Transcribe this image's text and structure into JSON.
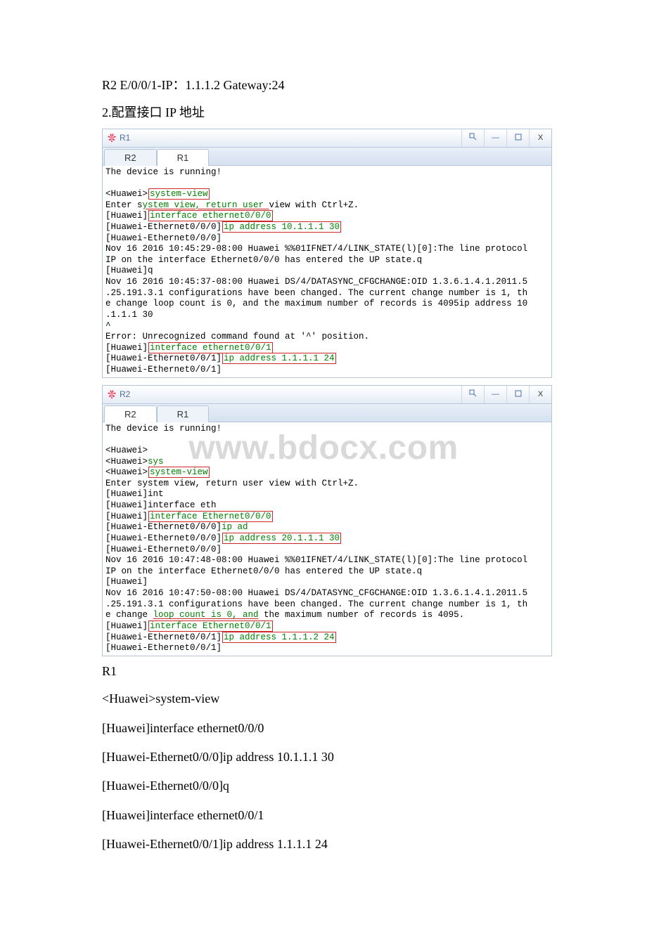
{
  "watermark": "www.bdocx.com",
  "heading1": "R2 E/0/0/1-IP：1.1.1.2 Gateway:24",
  "heading2": "2.配置接口 IP 地址",
  "windows": [
    {
      "title": "R1",
      "tabs": [
        "R2",
        "R1"
      ],
      "activeTab": 1,
      "lines": [
        {
          "pre": "The device is running!",
          "hl": ""
        },
        {
          "pre": "",
          "hl": ""
        },
        {
          "pre": "<Huawei>",
          "hl": "system-view"
        },
        {
          "pre": "Enter s",
          "underline": "ystem view, return user ",
          "post": "view with Ctrl+Z."
        },
        {
          "pre": "[Huawei]",
          "hl": "interface ethernet0/0/0"
        },
        {
          "pre": "[Huawei-Ethernet0/0/0]",
          "hl": "ip address 10.1.1.1 30"
        },
        {
          "pre": "[Huawei-Ethernet0/0/0]",
          "hl": ""
        },
        {
          "pre": "Nov 16 2016 10:45:29-08:00 Huawei %%01IFNET/4/LINK_STATE(l)[0]:The line protocol",
          "hl": ""
        },
        {
          "pre": " IP on the interface Ethernet0/0/0 has entered the UP state.q",
          "hl": ""
        },
        {
          "pre": "[Huawei]q",
          "hl": ""
        },
        {
          "pre": "Nov 16 2016 10:45:37-08:00 Huawei DS/4/DATASYNC_CFGCHANGE:OID 1.3.6.1.4.1.2011.5",
          "hl": ""
        },
        {
          "pre": ".25.191.3.1 configurations have been changed. The current change number is 1, th",
          "hl": ""
        },
        {
          "pre": "e change loop count is 0, and the maximum number of records is 4095ip address 10",
          "hl": ""
        },
        {
          "pre": ".1.1.1 30",
          "hl": ""
        },
        {
          "pre": "          ^",
          "hl": ""
        },
        {
          "pre": "Error: Unrecognized command found at '^' position.",
          "hl": ""
        },
        {
          "pre": "[Huawei]",
          "hl": "interface ethernet0/0/1"
        },
        {
          "pre": "[Huawei-Ethernet0/0/1]",
          "hl": "ip address 1.1.1.1 24"
        },
        {
          "pre": "[Huawei-Ethernet0/0/1]",
          "hl": ""
        }
      ]
    },
    {
      "title": "R2",
      "tabs": [
        "R2",
        "R1"
      ],
      "activeTab": 0,
      "lines": [
        {
          "pre": "The device is running!",
          "hl": ""
        },
        {
          "pre": "",
          "hl": ""
        },
        {
          "pre": "<Huawei>",
          "hl": ""
        },
        {
          "pre": "<Huawei>",
          "green": "sys"
        },
        {
          "pre": "<Huawei>",
          "hl": "system-view"
        },
        {
          "pre": "Enter system view, return user view with Ctrl+Z.",
          "hl": ""
        },
        {
          "pre": "[Huawei]int",
          "hl": ""
        },
        {
          "pre": "[Huawei]interface eth",
          "hl": ""
        },
        {
          "pre": "[Huawei]",
          "hl": "interface Ethernet0/0/0"
        },
        {
          "pre": "[Huawei-Ethernet0/0/0]",
          "green": "ip ad"
        },
        {
          "pre": "[Huawei-Ethernet0/0/0]",
          "hl": "ip address 20.1.1.1 30"
        },
        {
          "pre": "[Huawei-Ethernet0/0/0]",
          "hl": ""
        },
        {
          "pre": "Nov 16 2016 10:47:48-08:00 Huawei %%01IFNET/4/LINK_STATE(l)[0]:The line protocol",
          "hl": ""
        },
        {
          "pre": " IP on the interface Ethernet0/0/0 has entered the UP state.q",
          "hl": ""
        },
        {
          "pre": "[Huawei]",
          "hl": ""
        },
        {
          "pre": "Nov 16 2016 10:47:50-08:00 Huawei DS/4/DATASYNC_CFGCHANGE:OID 1.3.6.1.4.1.2011.5",
          "hl": ""
        },
        {
          "pre": ".25.191.3.1 configurations have been changed. The current change number is 1, th",
          "hl": ""
        },
        {
          "pre": "e change ",
          "underline": "loop count is 0, and",
          "post": " the maximum number of records is 4095."
        },
        {
          "pre": "[Huawei]",
          "hl": "interface Ethernet0/0/1"
        },
        {
          "pre": "[Huawei-Ethernet0/0/1]",
          "hl": "ip address 1.1.1.2 24"
        },
        {
          "pre": "[Huawei-Ethernet0/0/1]",
          "hl": ""
        }
      ]
    }
  ],
  "controls": {
    "pin": "⬚",
    "min": "—",
    "max": "▢",
    "close": "X"
  },
  "postLabel": "R1",
  "commands": [
    "<Huawei>system-view",
    "[Huawei]interface ethernet0/0/0",
    "[Huawei-Ethernet0/0/0]ip address 10.1.1.1 30",
    "[Huawei-Ethernet0/0/0]q",
    "[Huawei]interface ethernet0/0/1",
    "[Huawei-Ethernet0/0/1]ip address 1.1.1.1 24"
  ]
}
